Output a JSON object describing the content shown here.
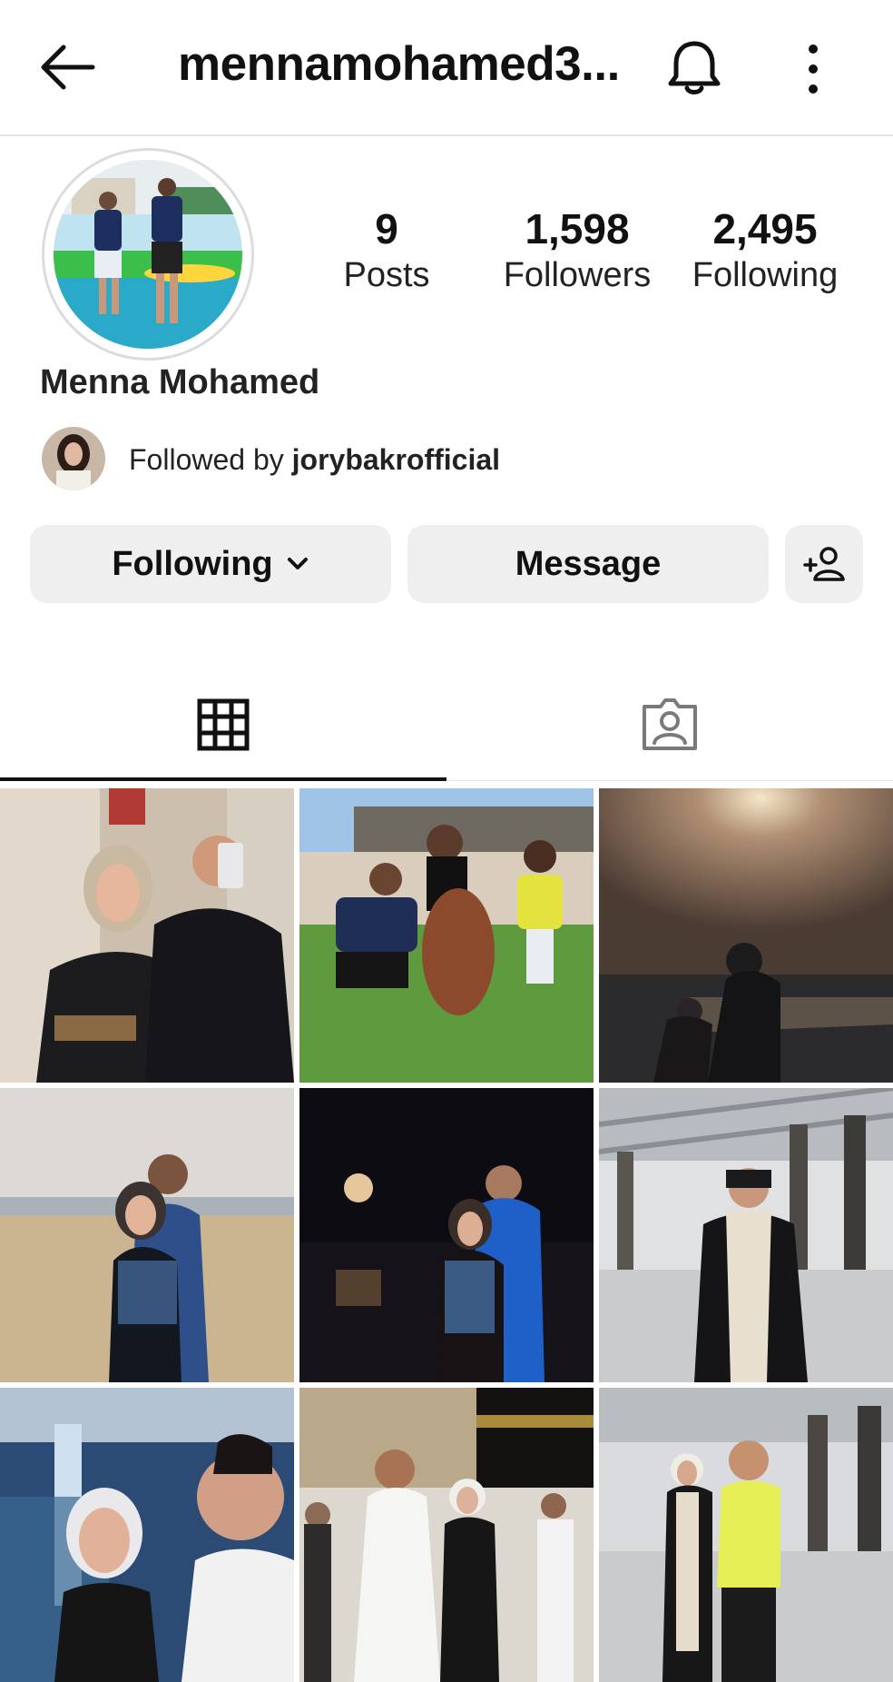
{
  "header": {
    "username": "mennamohamed3...",
    "back_icon": "back-arrow-icon",
    "bell_icon": "bell-icon",
    "more_icon": "more-vertical-icon"
  },
  "profile": {
    "full_name": "Menna Mohamed",
    "stats": [
      {
        "value": "9",
        "label": "Posts"
      },
      {
        "value": "1,598",
        "label": "Followers"
      },
      {
        "value": "2,495",
        "label": "Following"
      }
    ],
    "followed_by_prefix": "Followed by ",
    "followed_by_user": "jorybakrofficial"
  },
  "actions": {
    "following_label": "Following",
    "message_label": "Message",
    "add_user_icon": "add-person-icon"
  },
  "tabs": [
    {
      "icon": "grid-icon",
      "active": true
    },
    {
      "icon": "tagged-person-icon",
      "active": false
    }
  ],
  "colors": {
    "button_bg": "#efefef",
    "text": "#111111",
    "divider": "#e4e4e4"
  }
}
